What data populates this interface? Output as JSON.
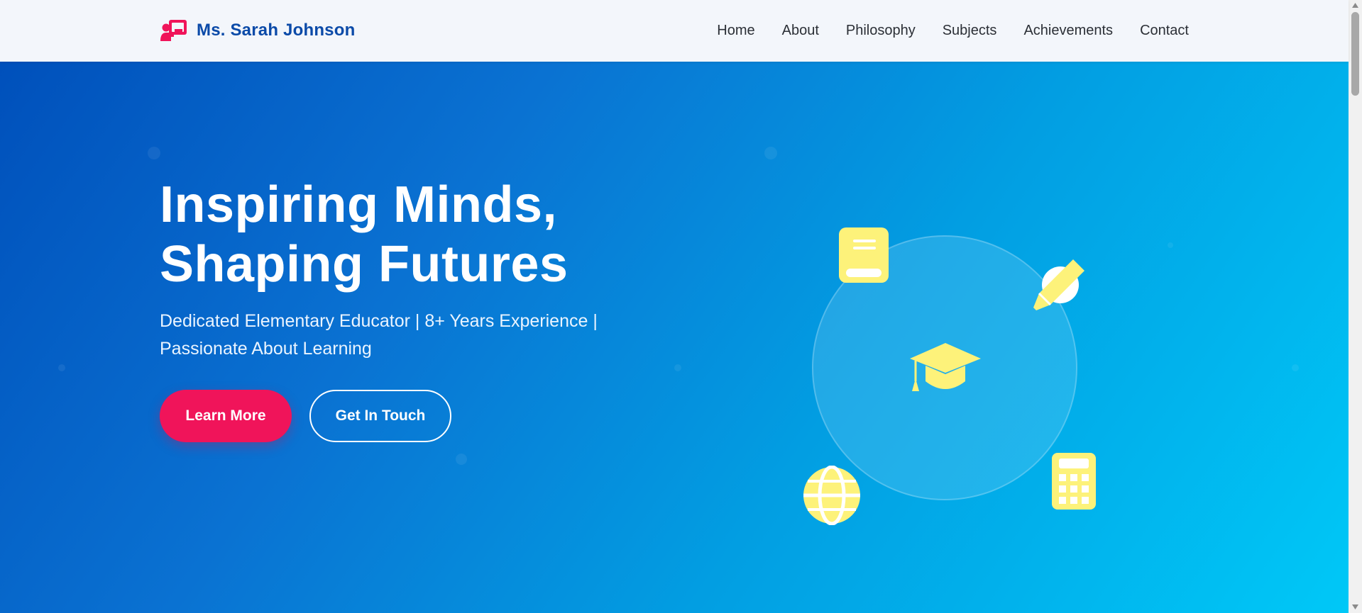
{
  "brand": {
    "name": "Ms. Sarah Johnson",
    "icon": "chalkboard-teacher-icon"
  },
  "nav": {
    "links": [
      "Home",
      "About",
      "Philosophy",
      "Subjects",
      "Achievements",
      "Contact"
    ]
  },
  "hero": {
    "title_line1": "Inspiring Minds,",
    "title_line2": "Shaping Futures",
    "subtitle": "Dedicated Elementary Educator | 8+ Years Experience | Passionate About Learning",
    "primary_button": "Learn More",
    "secondary_button": "Get In Touch"
  },
  "visual": {
    "center_icon": "graduation-cap-icon",
    "orbit_icons": [
      "book-icon",
      "pencil-icon",
      "globe-icon",
      "calculator-icon"
    ],
    "icon_color": "#fdf27a"
  },
  "colors": {
    "brand": "#0b4aa8",
    "accent": "#f0145a",
    "hero_start": "#0050bb",
    "hero_end": "#00c8f7"
  }
}
